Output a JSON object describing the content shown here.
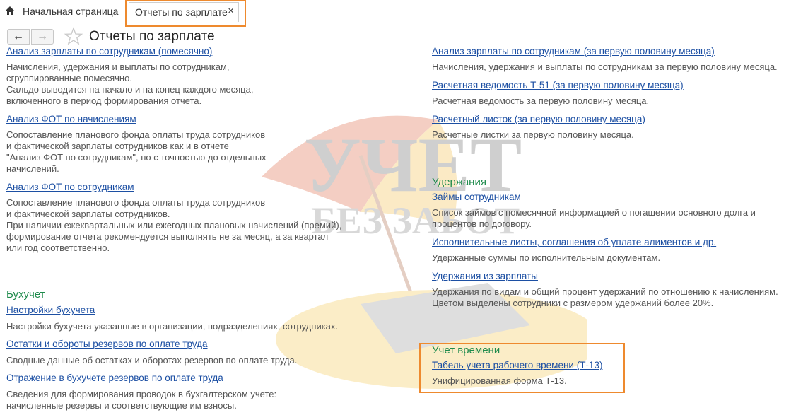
{
  "tabs": {
    "home_label": "Начальная страница",
    "active_label": "Отчеты по зарплате",
    "close_glyph": "×"
  },
  "header": {
    "back_glyph": "←",
    "forward_glyph": "→",
    "title": "Отчеты по зарплате"
  },
  "left": {
    "top_link": "Анализ зарплаты по сотрудникам (помесячно)",
    "top_desc": "Начисления, удержания и выплаты по сотрудникам,\nсгруппированные помесячно.\nСальдо выводится на начало и на конец каждого месяца,\nвключенного в период формирования отчета.",
    "fot_accruals_link": "Анализ ФОТ по начислениям",
    "fot_accruals_desc": "Сопоставление планового фонда оплаты труда сотрудников\nи фактической зарплаты сотрудников как и в отчете\n\"Анализ ФОТ по сотрудникам\", но с точностью до отдельных\nначислений.",
    "fot_employees_link": "Анализ ФОТ по сотрудникам",
    "fot_employees_desc": "Сопоставление планового фонда оплаты труда сотрудников\nи фактической зарплаты сотрудников.\nПри наличии ежеквартальных или ежегодных плановых начислений (премий),\nформирование отчета рекомендуется выполнять не за месяц, а за квартал\nили год соответственно.",
    "accounting_section": "Бухучет",
    "acc_settings_link": "Настройки бухучета",
    "acc_settings_desc": "Настройки бухучета указанные в организации, подразделениях, сотрудниках.",
    "reserves_link": "Остатки и обороты резервов по оплате труда",
    "reserves_desc": "Сводные данные об остатках и оборотах резервов по оплате труда.",
    "reflect_link": "Отражение в бухучете резервов по оплате труда",
    "reflect_desc": "Сведения для формирования проводок в бухгалтерском учете:\nначисленные резервы и соответствующие им взносы."
  },
  "right": {
    "top_link": "Анализ зарплаты по сотрудникам (за первую половину месяца)",
    "top_desc": "Начисления, удержания и выплаты по сотрудникам за первую половину месяца.",
    "t51_link": "Расчетная ведомость Т-51 (за первую половину месяца)",
    "t51_desc": "Расчетная ведомость за первую половину месяца.",
    "payslip_link": "Расчетный листок (за первую половину месяца)",
    "payslip_desc": "Расчетные листки за первую половину месяца.",
    "deductions_section": "Удержания",
    "loans_link": "Займы сотрудникам",
    "loans_desc": "Список займов с помесячной информацией о погашении основного долга и\nпроцентов по договору.",
    "writs_link": "Исполнительные листы, соглашения об уплате алиментов и др.",
    "writs_desc": "Удержанные суммы по исполнительным документам.",
    "salary_ded_link": "Удержания из зарплаты",
    "salary_ded_desc": "Удержания по видам и общий процент удержаний по отношению к начислениям.\nЦветом выделены сотрудники с размером удержаний более 20%.",
    "time_section": "Учет времени",
    "t13_link": "Табель учета рабочего времени (Т-13)",
    "t13_desc": "Унифицированная форма Т-13."
  },
  "watermark": {
    "line1": "УЧЕТ",
    "line2": "БЕЗ ЗАБОТ"
  },
  "colors": {
    "link": "#1c4fa3",
    "section": "#1f8b4c",
    "highlight": "#ee8a2e"
  }
}
